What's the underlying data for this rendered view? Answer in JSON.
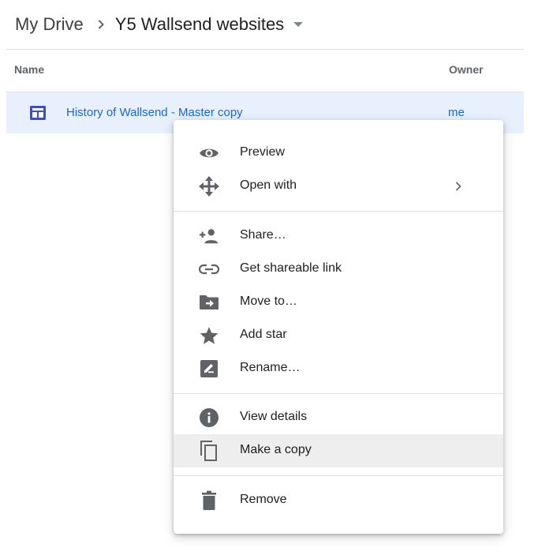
{
  "breadcrumb": {
    "root": "My Drive",
    "current": "Y5 Wallsend websites"
  },
  "list": {
    "columns": {
      "name": "Name",
      "owner": "Owner"
    },
    "rows": [
      {
        "name": "History of Wallsend - Master copy",
        "owner": "me",
        "icon": "google-sites-icon"
      }
    ]
  },
  "context_menu": {
    "groups": [
      [
        {
          "label": "Preview",
          "icon": "eye-icon"
        },
        {
          "label": "Open with",
          "icon": "move-arrows-icon",
          "has_submenu": true
        }
      ],
      [
        {
          "label": "Share…",
          "icon": "person-add-icon"
        },
        {
          "label": "Get shareable link",
          "icon": "link-icon"
        },
        {
          "label": "Move to…",
          "icon": "folder-move-icon"
        },
        {
          "label": "Add star",
          "icon": "star-icon"
        },
        {
          "label": "Rename…",
          "icon": "edit-icon"
        }
      ],
      [
        {
          "label": "View details",
          "icon": "info-icon"
        },
        {
          "label": "Make a copy",
          "icon": "copy-icon",
          "highlighted": true
        }
      ],
      [
        {
          "label": "Remove",
          "icon": "trash-icon"
        }
      ]
    ]
  },
  "colors": {
    "selected_row_bg": "#e8f0fe",
    "link_blue": "#1967d2",
    "sites_icon": "#3f51b5",
    "menu_icon": "#5f6368",
    "hover_bg": "#eeeeee"
  }
}
